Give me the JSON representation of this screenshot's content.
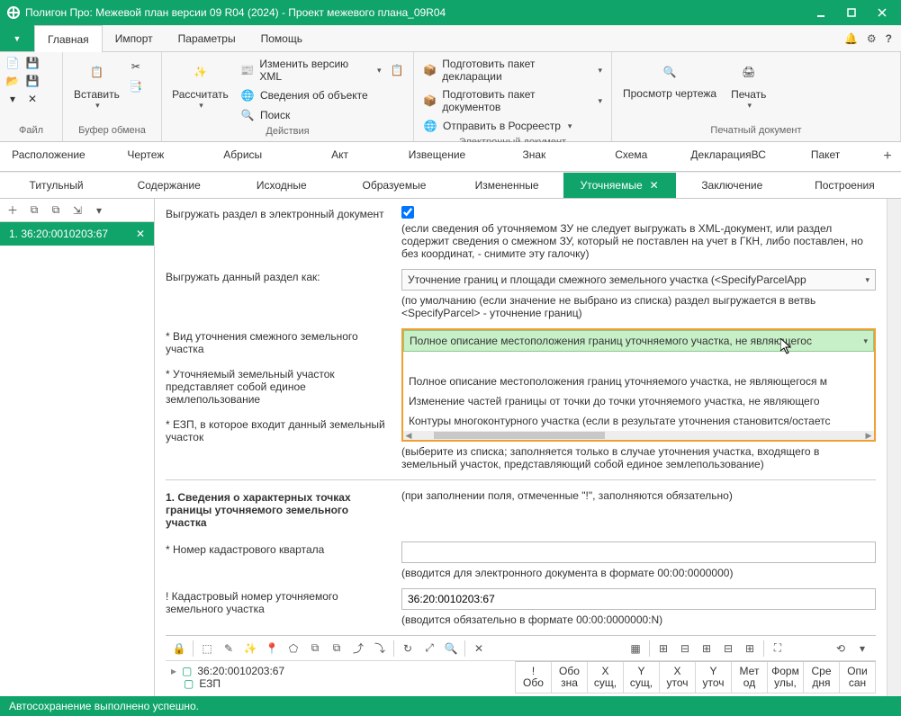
{
  "window": {
    "title": "Полигон Про: Межевой план версии 09 R04 (2024) - Проект межевого плана_09R04"
  },
  "menu": {
    "tabs": [
      "Главная",
      "Импорт",
      "Параметры",
      "Помощь"
    ],
    "active": 0
  },
  "ribbon": {
    "file": {
      "label": "Файл"
    },
    "clip": {
      "paste": "Вставить",
      "label": "Буфер обмена"
    },
    "actions": {
      "calc": "Рассчитать",
      "xml": "Изменить версию XML",
      "info": "Сведения об объекте",
      "search": "Поиск",
      "label": "Действия"
    },
    "edoc": {
      "d1": "Подготовить пакет декларации",
      "d2": "Подготовить пакет документов",
      "d3": "Отправить в Росреестр",
      "label": "Электронный документ"
    },
    "print": {
      "b1": "Просмотр чертежа",
      "b2": "Печать",
      "label": "Печатный документ"
    }
  },
  "tabs1": [
    "Расположение",
    "Чертеж",
    "Абрисы",
    "Акт",
    "Извещение",
    "Знак",
    "Схема",
    "ДекларацияВС",
    "Пакет"
  ],
  "tabs2": [
    "Титульный",
    "Содержание",
    "Исходные",
    "Образуемые",
    "Измененные",
    "Уточняемые",
    "Заключение",
    "Построения"
  ],
  "tabs2_active": 5,
  "nav": {
    "item": "1.  36:20:0010203:67"
  },
  "form": {
    "r1": {
      "label": "Выгружать раздел в электронный документ",
      "hint": "(если сведения об уточняемом ЗУ не следует выгружать в XML-документ, или раздел содержит сведения о смежном ЗУ, который не поставлен на учет в ГКН, либо поставлен, но без координат, - снимите эту галочку)"
    },
    "r2": {
      "label": "Выгружать данный раздел как:",
      "value": "Уточнение границ и площади смежного земельного участка (<SpecifyParcelApp",
      "hint": "(по умолчанию (если значение не выбрано из списка) раздел выгружается в ветвь <SpecifyParcel> - уточнение границ)"
    },
    "r3": {
      "label": "* Вид уточнения смежного земельного участка",
      "selected": "Полное описание местоположения границ уточняемого участка, не являющегос",
      "opts": [
        "Полное описание местоположения границ уточняемого участка, не являющегося м",
        "Изменение частей границы от точки до точки уточняемого участка, не являющего",
        "Контуры многоконтурного участка (если в результате уточнения становится/остаетс"
      ]
    },
    "r4": {
      "label": "* Уточняемый земельный участок представляет собой единое землепользование"
    },
    "r5": {
      "label": "* ЕЗП, в которое входит данный земельный участок",
      "hint": "(выберите из списка; заполняется только в случае уточнения участка, входящего в земельный участок, представляющий собой единое землепользование)"
    },
    "sec": "1. Сведения о характерных точках границы уточняемого земельного участка",
    "sec_hint": "(при заполнении поля, отмеченные \"!\", заполняются обязательно)",
    "r6": {
      "label": "* Номер кадастрового квартала",
      "hint": "(вводится для электронного документа в формате 00:00:0000000)"
    },
    "r7": {
      "label": "! Кадастровый номер уточняемого земельного участка",
      "value": "36:20:0010203:67",
      "hint": "(вводится обязательно в формате 00:00:0000000:N)"
    }
  },
  "grid": {
    "tree": "36:20:0010203:67",
    "tree2": "ЕЗП",
    "cols": [
      [
        "!",
        "Обо"
      ],
      [
        "Обо",
        "зна"
      ],
      [
        "X",
        "сущ,"
      ],
      [
        "Y",
        "сущ,"
      ],
      [
        "X",
        "уточ"
      ],
      [
        "Y",
        "уточ"
      ],
      [
        "Мет",
        "од"
      ],
      [
        "Форм",
        "улы,"
      ],
      [
        "Сре",
        "дня"
      ],
      [
        "Опи",
        "сан"
      ]
    ]
  },
  "status": "Автосохранение выполнено успешно."
}
